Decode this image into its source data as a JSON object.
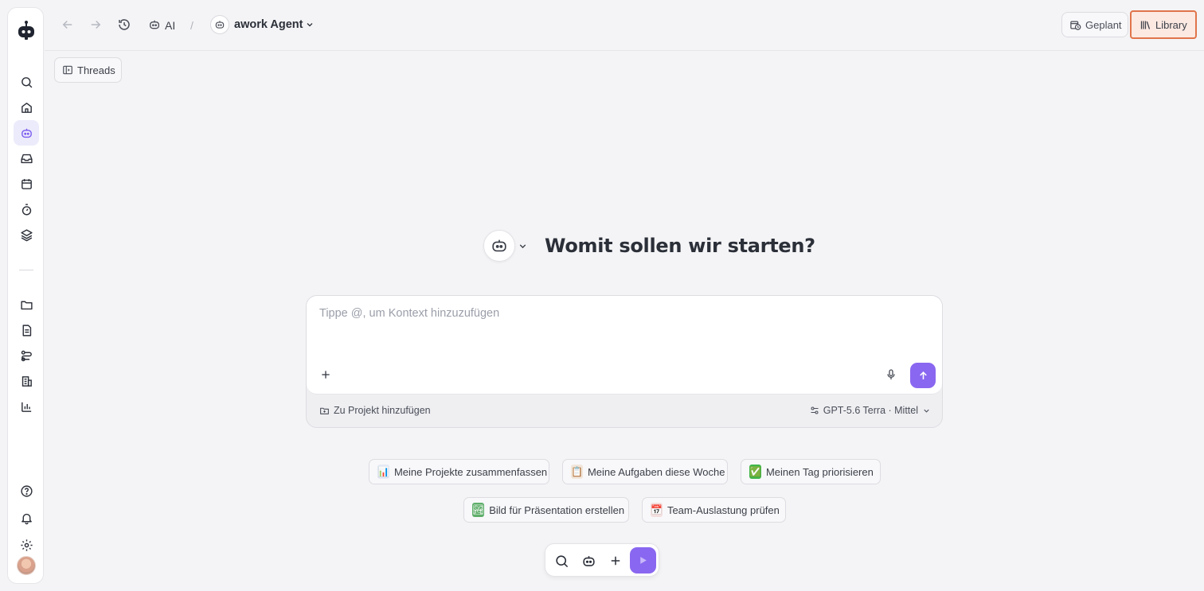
{
  "colors": {
    "accent": "#8a67f0",
    "highlight_border": "#e0744a",
    "background": "#f4f4f6"
  },
  "sidebar": {
    "logo_icon": "robot-logo-icon",
    "nav_top": [
      "search-icon",
      "home-icon",
      "agent-icon",
      "inbox-icon",
      "calendar-icon",
      "timer-icon",
      "layers-icon"
    ],
    "nav_mid": [
      "folder-icon",
      "document-icon",
      "workflow-icon",
      "building-icon",
      "chart-icon"
    ],
    "nav_bottom": [
      "help-icon",
      "bell-icon",
      "gear-icon"
    ],
    "active_item": "agent-icon"
  },
  "topbar": {
    "crumb_ai": "AI",
    "crumb_separator": "/",
    "agent_name": "awork Agent",
    "geplant_label": "Geplant",
    "library_label": "Library"
  },
  "threads_label": "Threads",
  "hero": {
    "title": "Womit sollen wir starten?"
  },
  "composer": {
    "placeholder": "Tippe @, um Kontext hinzuzufügen",
    "value": "",
    "project_label": "Zu Projekt hinzufügen",
    "model_label": "GPT-5.6 Terra · Mittel"
  },
  "suggestions": [
    {
      "emoji": "📊",
      "label": "Meine Projekte zusammenfassen"
    },
    {
      "emoji": "📋",
      "label": "Meine Aufgaben diese Woche"
    },
    {
      "emoji": "✅",
      "label": "Meinen Tag priorisieren"
    },
    {
      "emoji": "🏞",
      "label": "Bild für Präsentation erstellen"
    },
    {
      "emoji": "📅",
      "label": "Team-Auslastung prüfen"
    }
  ],
  "dock": [
    "search-icon",
    "agent-icon",
    "plus-icon",
    "play-icon"
  ]
}
